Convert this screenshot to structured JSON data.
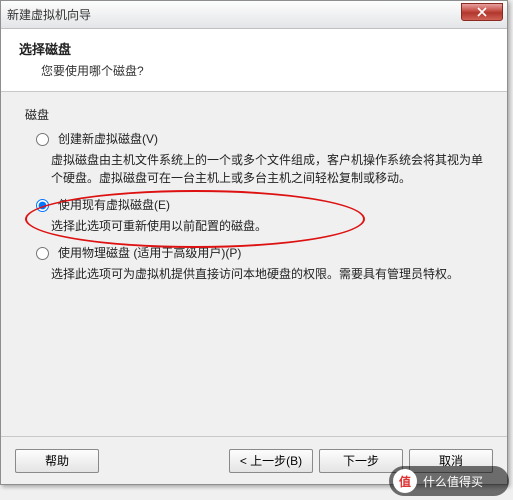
{
  "titlebar": {
    "title": "新建虚拟机向导"
  },
  "header": {
    "title": "选择磁盘",
    "subtitle": "您要使用哪个磁盘?"
  },
  "section_label": "磁盘",
  "options": [
    {
      "label": "创建新虚拟磁盘(V)",
      "desc": "虚拟磁盘由主机文件系统上的一个或多个文件组成，客户机操作系统会将其视为单个硬盘。虚拟磁盘可在一台主机上或多台主机之间轻松复制或移动。",
      "checked": false
    },
    {
      "label": "使用现有虚拟磁盘(E)",
      "desc": "选择此选项可重新使用以前配置的磁盘。",
      "checked": true
    },
    {
      "label": "使用物理磁盘 (适用于高级用户)(P)",
      "desc": "选择此选项可为虚拟机提供直接访问本地硬盘的权限。需要具有管理员特权。",
      "checked": false
    }
  ],
  "footer": {
    "help": "帮助",
    "back": "< 上一步(B)",
    "next": "下一步",
    "cancel": "取消"
  },
  "watermark": {
    "badge": "值",
    "text": "什么值得买"
  }
}
